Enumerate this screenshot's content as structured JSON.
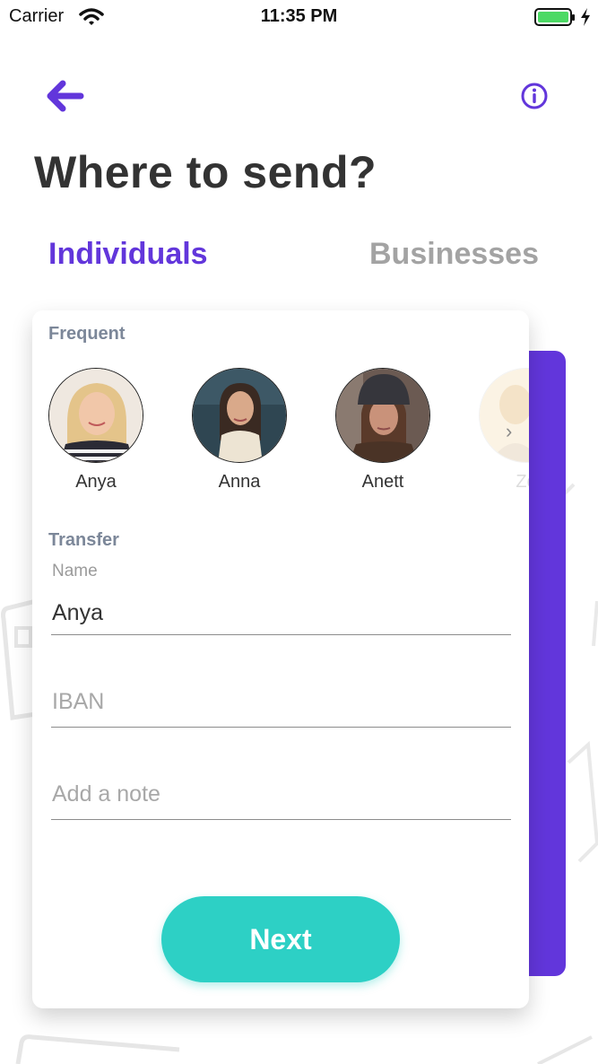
{
  "status_bar": {
    "carrier": "Carrier",
    "time": "11:35 PM",
    "battery_color": "#4cd964"
  },
  "header": {
    "back_icon": "arrow-left-icon",
    "info_icon": "info-circle-icon",
    "title": "Where to send?"
  },
  "tabs": [
    {
      "label": "Individuals",
      "active": true,
      "color": "#6236db"
    },
    {
      "label": "Businesses",
      "active": false,
      "color": "#a3a3a3"
    }
  ],
  "frequent": {
    "label": "Frequent",
    "contacts": [
      {
        "name": "Anya"
      },
      {
        "name": "Anna"
      },
      {
        "name": "Anett"
      },
      {
        "name": "Zo"
      }
    ]
  },
  "transfer": {
    "label": "Transfer",
    "name_label": "Name",
    "name_value": "Anya",
    "iban_placeholder": "IBAN",
    "note_placeholder": "Add a note"
  },
  "next_button": {
    "label": "Next",
    "color": "#2dd0c5"
  },
  "accent_color": "#6236db"
}
